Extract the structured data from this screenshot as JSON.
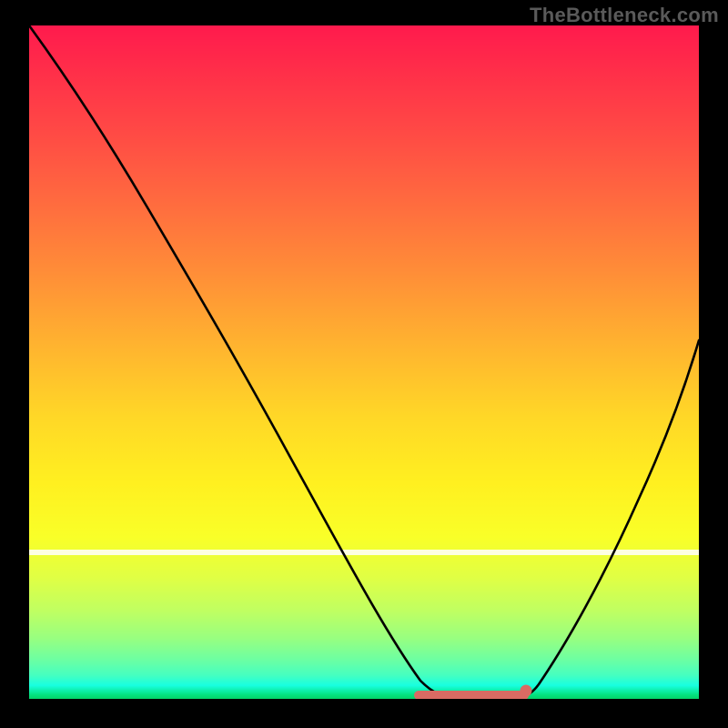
{
  "watermark": "TheBottleneck.com",
  "chart_data": {
    "type": "line",
    "title": "",
    "xlabel": "",
    "ylabel": "",
    "xlim": [
      0,
      100
    ],
    "ylim": [
      0,
      100
    ],
    "grid": false,
    "legend": false,
    "x": [
      0,
      5,
      10,
      15,
      20,
      25,
      30,
      35,
      40,
      45,
      50,
      55,
      58,
      60,
      63,
      66,
      70,
      73,
      76,
      80,
      85,
      90,
      95,
      100
    ],
    "values": [
      100,
      94,
      87,
      79,
      71,
      62,
      53,
      44,
      35,
      26,
      18,
      10,
      5,
      2,
      0,
      0,
      0,
      0,
      2,
      6,
      14,
      25,
      38,
      54
    ],
    "note": "Qualitative V-shaped bottleneck curve. Values are read from the plotted line height against the gradient background; y axis is interpreted 0 at bottom, 100 at top. Flat minimum around 0 from x≈63 to x≈73 is highlighted with a salmon underline and a dot near x≈73.",
    "highlight": {
      "x_start": 58,
      "x_end": 74,
      "color": "#d96b63"
    },
    "highlight_dot": {
      "x": 74,
      "y": 1,
      "color": "#d96b63"
    },
    "background_gradient": {
      "top": "#ff1a4d",
      "mid": "#ffd727",
      "bottom": "#04d268"
    },
    "white_accent_stripe_y": 22
  }
}
